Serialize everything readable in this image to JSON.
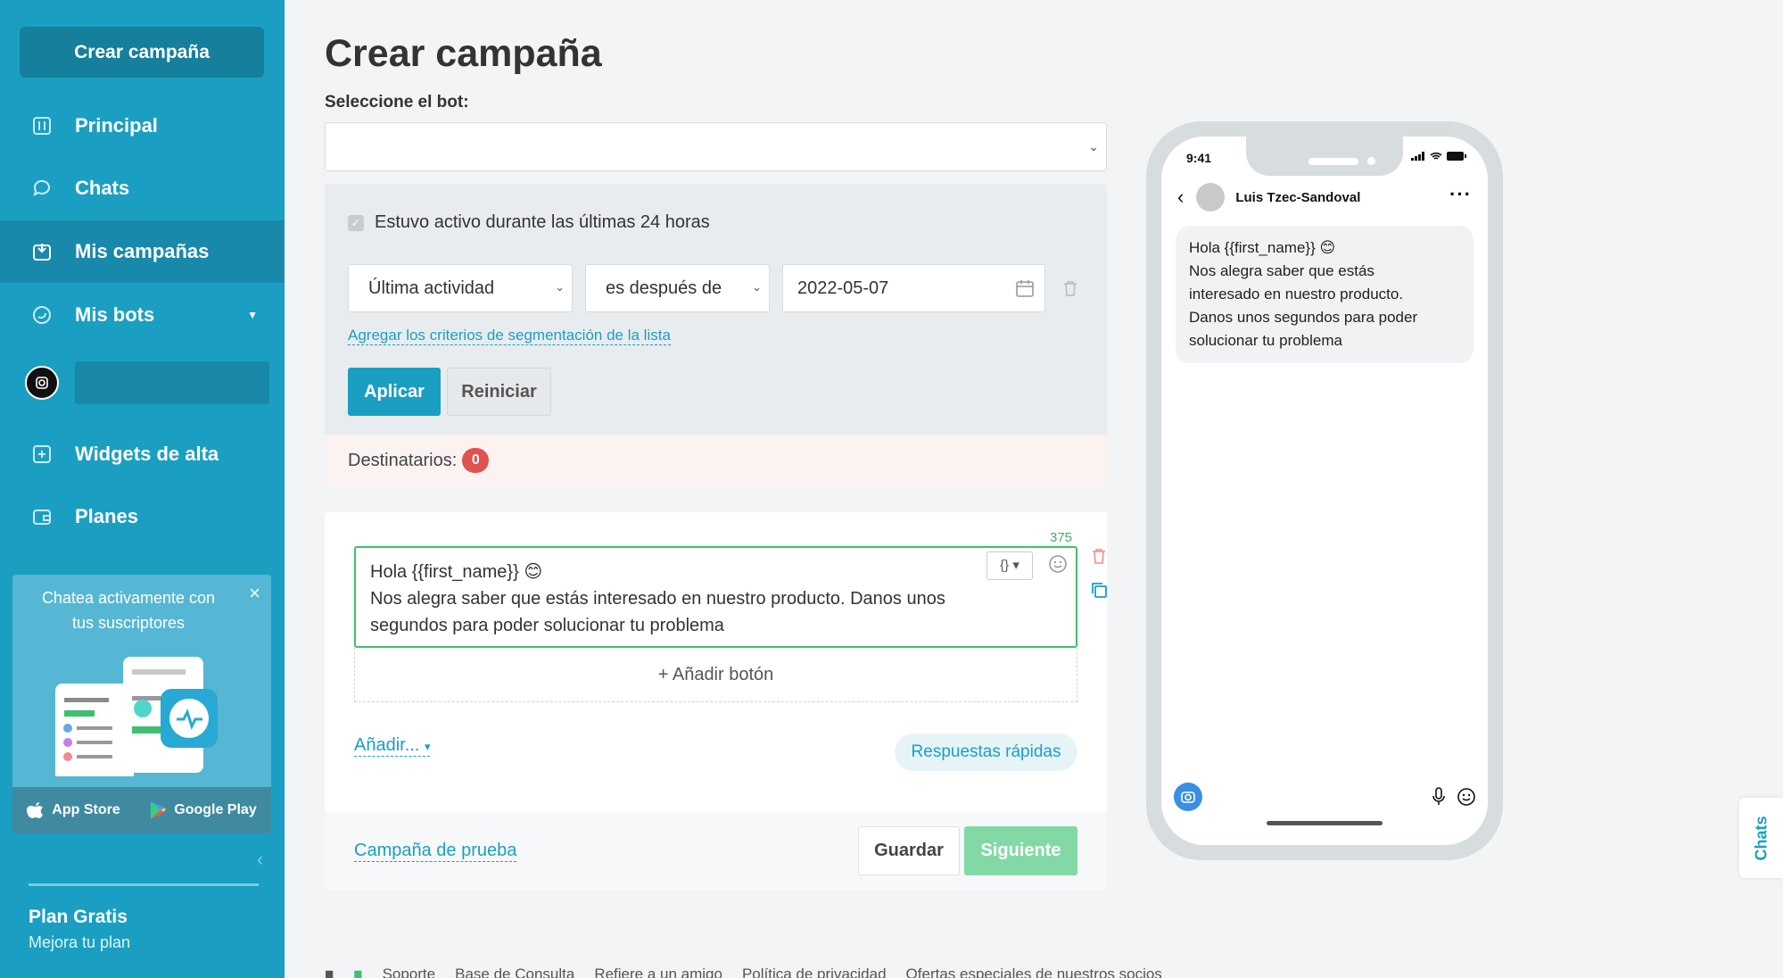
{
  "sidebar": {
    "create_label": "Crear campaña",
    "items": [
      {
        "label": "Principal"
      },
      {
        "label": "Chats"
      },
      {
        "label": "Mis campañas"
      },
      {
        "label": "Mis bots"
      },
      {
        "label": "Widgets de alta"
      },
      {
        "label": "Planes"
      }
    ],
    "promo": {
      "text": "Chatea activamente con tus suscriptores",
      "app_store": "App Store",
      "google_play": "Google Play"
    },
    "plan": {
      "title": "Plan Gratis",
      "subtitle": "Mejora tu plan"
    }
  },
  "main": {
    "title": "Crear campaña",
    "bot_label": "Seleccione el bot:",
    "bot_value": "",
    "filter": {
      "active_label": "Estuvo activo durante las últimas 24 horas",
      "field": "Última actividad",
      "operator": "es después de",
      "date": "2022-05-07",
      "segment_link": "Agregar los criterios de segmentación de la lista",
      "apply": "Aplicar",
      "reset": "Reiniciar"
    },
    "recipients_label": "Destinatarios:",
    "recipients_count": "0",
    "message": {
      "char_count": "375",
      "line1": "Hola  {{first_name}}  😊",
      "line2": "Nos alegra saber que estás interesado en nuestro producto. Danos unos",
      "line3": "segundos para poder solucionar tu problema",
      "var_button": "{}",
      "add_button": "+ Añadir botón",
      "add_link": "Añadir...",
      "quick_replies": "Respuestas rápidas"
    },
    "footer": {
      "test_link": "Campaña de prueba",
      "save": "Guardar",
      "next": "Siguiente"
    }
  },
  "footer_links": [
    "Soporte",
    "Base de Consulta",
    "Refiere a un amigo",
    "Política de privacidad",
    "Ofertas especiales de nuestros socios"
  ],
  "phone": {
    "time": "9:41",
    "contact": "Luis Tzec-Sandoval",
    "bubble": {
      "l1": "Hola  {{first_name}}  😊",
      "l2": "Nos alegra saber que estás",
      "l3": "interesado en nuestro producto.",
      "l4": "Danos unos segundos para poder",
      "l5": "solucionar tu problema"
    }
  },
  "chats_tab": "Chats",
  "colors": {
    "primary": "#1a9fc2",
    "success": "#3fbf6f",
    "danger": "#e0534f"
  }
}
